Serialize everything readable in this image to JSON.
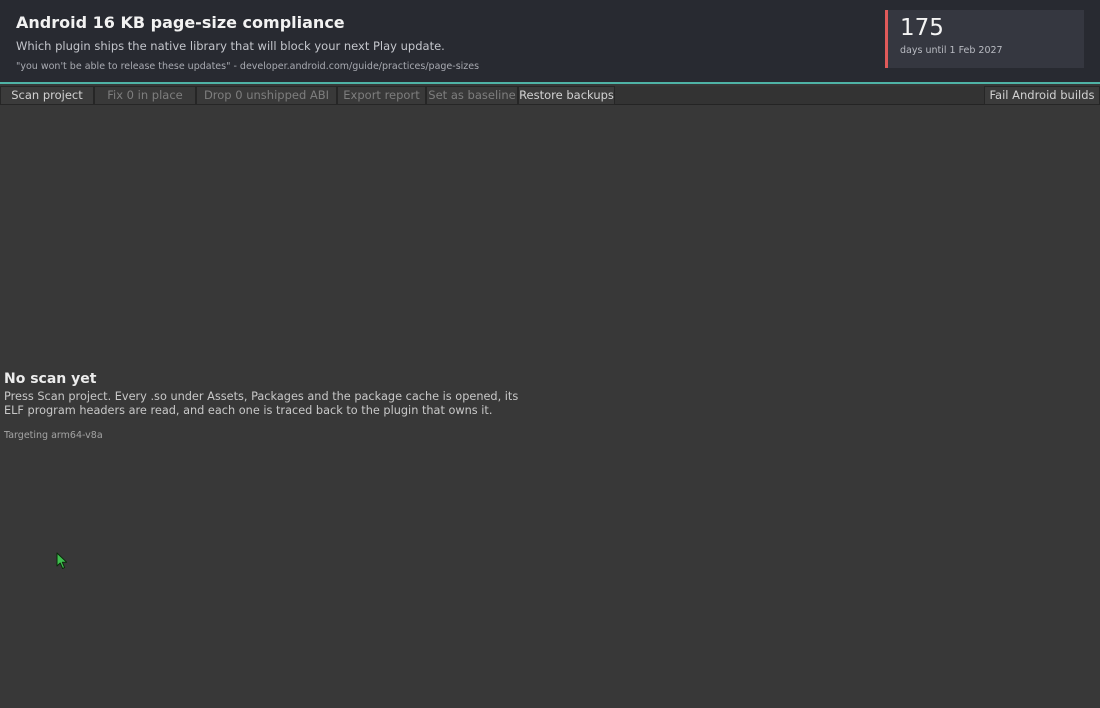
{
  "header": {
    "title": "Android 16 KB page-size compliance",
    "subtitle": "Which plugin ships the native library that will block your next Play update.",
    "quote": "\"you won't be able to release these updates\" - developer.android.com/guide/practices/page-sizes"
  },
  "deadline": {
    "days": "175",
    "caption": "days until 1 Feb 2027",
    "accent_color": "#e05a5a"
  },
  "toolbar": {
    "scan_label": "Scan project",
    "fix_label": "Fix 0 in place",
    "drop_label": "Drop 0 unshipped ABI",
    "export_label": "Export report",
    "baseline_label": "Set as baseline",
    "restore_label": "Restore backups",
    "fail_label": "Fail Android builds"
  },
  "empty_state": {
    "title": "No scan yet",
    "description": "Press Scan project. Every .so under Assets, Packages and the package cache is opened, its ELF program headers are read, and each one is traced back to the plugin that owns it.",
    "target": "Targeting arm64-v8a"
  },
  "colors": {
    "header_accent": "#4fb3a6",
    "background": "#383838",
    "header_background": "#282a31"
  },
  "icons": {
    "cursor": "mouse-pointer-icon"
  }
}
